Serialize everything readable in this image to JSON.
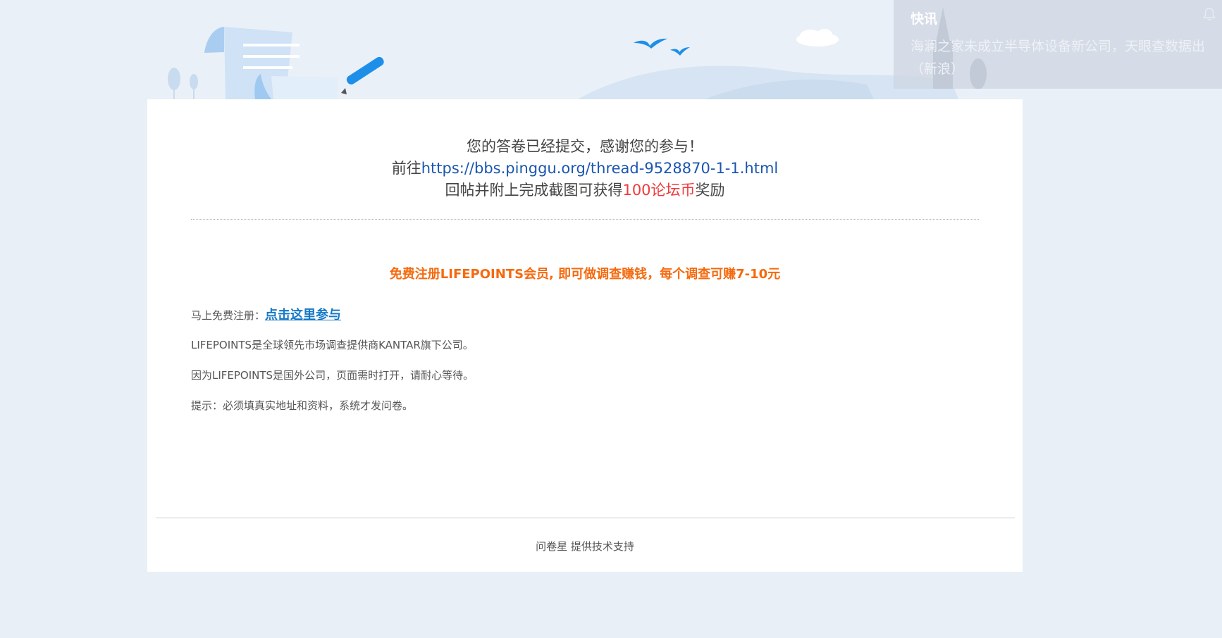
{
  "message": {
    "line1": "您的答卷已经提交，感谢您的参与！",
    "line2_prefix": "前往",
    "line2_link": "https://bbs.pinggu.org/thread-9528870-1-1.html",
    "line3_prefix": "回帖并附上完成截图可获得",
    "line3_reward": "100论坛币",
    "line3_suffix": "奖励"
  },
  "promo": {
    "headline": "免费注册LIFEPOINTS会员, 即可做调查赚钱，每个调查可赚7-10元",
    "register_label": "马上免费注册：",
    "register_link": "点击这里参与",
    "info1": "LIFEPOINTS是全球领先市场调查提供商KANTAR旗下公司。",
    "info2": "因为LIFEPOINTS是国外公司，页面需时打开，请耐心等待。",
    "info3": "提示：必须填真实地址和资料，系统才发问卷。"
  },
  "footer": {
    "brand": "问卷星",
    "text": "提供技术支持"
  },
  "news": {
    "title": "快讯",
    "text": "海澜之家未成立半导体设备新公司，天眼查数据出",
    "source": "（新浪）",
    "bell_icon": "bell-icon"
  },
  "colors": {
    "link": "#1a56b0",
    "reward": "#f0393b",
    "promo": "#f56a0e",
    "join": "#1578c7",
    "background": "#e9eff7"
  }
}
